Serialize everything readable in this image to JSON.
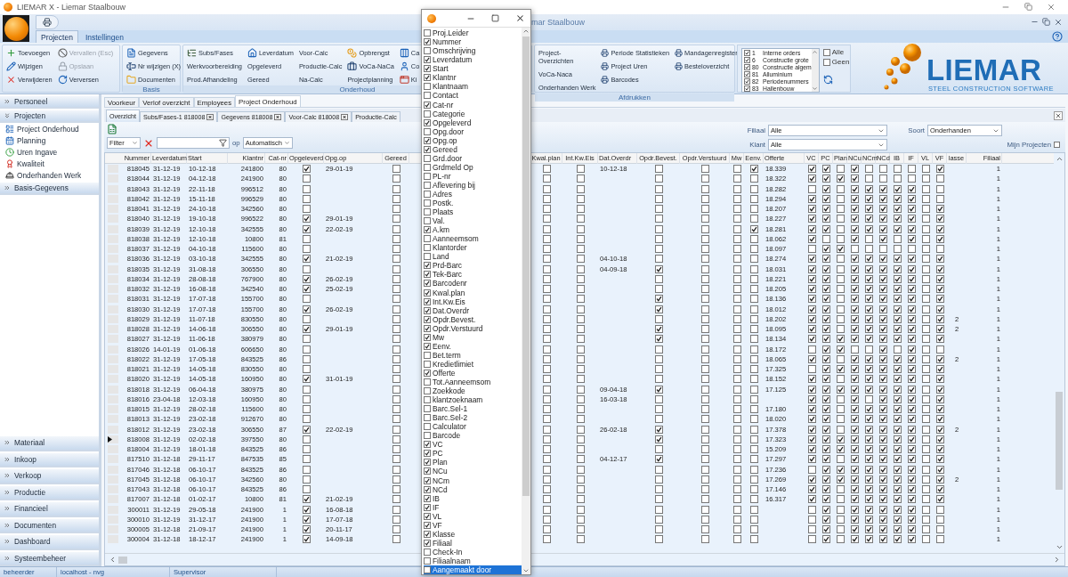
{
  "window": {
    "title": "LIEMAR X - Liemar Staalbouw"
  },
  "inner_window": {
    "title": "mar Staalbouw"
  },
  "ribbon_tabs": [
    {
      "label": "Projecten",
      "selected": true
    },
    {
      "label": "Instellingen",
      "selected": false
    }
  ],
  "ribbon_groups": [
    {
      "columns": [
        [
          {
            "label": "Toevoegen",
            "disabled": false
          },
          {
            "label": "Wijzigen",
            "disabled": false
          },
          {
            "label": "Verwijderen",
            "disabled": false
          }
        ],
        [
          {
            "label": "Vervallen (Esc)",
            "disabled": true
          },
          {
            "label": "Opslaan",
            "disabled": true
          },
          {
            "label": "Verversen",
            "disabled": false
          }
        ]
      ]
    },
    {
      "label": "Basis",
      "columns": [
        [
          {
            "label": "Gegevens",
            "disabled": false
          },
          {
            "label": "Nr wijzigen (X)",
            "disabled": false
          },
          {
            "label": "Documenten",
            "disabled": false
          }
        ]
      ]
    },
    {
      "label": "Onderhoud",
      "columns": [
        [
          {
            "label": "Subs/Fases",
            "disabled": false
          },
          {
            "label": "Werkvoorbereiding",
            "disabled": false
          },
          {
            "label": "Prod.Afhandeling",
            "disabled": false
          }
        ],
        [
          {
            "label": "Leverdatum",
            "disabled": false
          },
          {
            "label": "Opgeleverd",
            "disabled": false
          },
          {
            "label": "Gereed",
            "disabled": false
          }
        ],
        [
          {
            "label": "Voor-Calc",
            "disabled": false
          },
          {
            "label": "Productie-Calc",
            "disabled": false
          },
          {
            "label": "Na-Calc",
            "disabled": false
          }
        ],
        [
          {
            "label": "Opbrengst",
            "disabled": false
          },
          {
            "label": "VoCa-NaCa",
            "disabled": false
          },
          {
            "label": "Projectplanning",
            "disabled": false
          }
        ],
        [
          {
            "label": "Ca",
            "disabled": false
          },
          {
            "label": "Co",
            "disabled": false
          },
          {
            "label": "Ki",
            "disabled": false
          }
        ]
      ]
    },
    {
      "label": "Afdrukken",
      "columns": [
        [
          {
            "label": "Project-Overzichten",
            "disabled": false
          },
          {
            "label": "VoCa-Naca",
            "disabled": false
          },
          {
            "label": "Onderhanden Werk",
            "disabled": false
          }
        ],
        [
          {
            "label": "Periode Statistieken",
            "disabled": false
          },
          {
            "label": "Project Uren",
            "disabled": false
          },
          {
            "label": "Barcodes",
            "disabled": false
          }
        ],
        [
          {
            "label": "Mandagenregister",
            "disabled": false
          },
          {
            "label": "Besteloverzicht",
            "disabled": false
          }
        ]
      ]
    }
  ],
  "category_list": [
    {
      "code": "1",
      "label": "Interne orders",
      "checked": true
    },
    {
      "code": "6",
      "label": "Constructie grote",
      "checked": true
    },
    {
      "code": "80",
      "label": "Constructie algem",
      "checked": true
    },
    {
      "code": "81",
      "label": "Alluminium",
      "checked": true
    },
    {
      "code": "82",
      "label": "Periodenummers",
      "checked": true
    },
    {
      "code": "83",
      "label": "Hallenbouw",
      "checked": true
    }
  ],
  "category_options": [
    {
      "label": "Alle",
      "checked": false
    },
    {
      "label": "Geen",
      "checked": false
    }
  ],
  "logo": {
    "name": "LIEMAR",
    "tagline": "STEEL CONSTRUCTION SOFTWARE"
  },
  "sidebar": {
    "top": [
      {
        "label": "Personeel",
        "expanded": false
      },
      {
        "label": "Projecten",
        "expanded": true,
        "items": [
          {
            "label": "Project Onderhoud"
          },
          {
            "label": "Planning"
          },
          {
            "label": "Uren Ingave"
          },
          {
            "label": "Kwaliteit"
          },
          {
            "label": "Onderhanden Werk"
          }
        ]
      },
      {
        "label": "Basis-Gegevens",
        "expanded": false
      }
    ],
    "bottom": [
      {
        "label": "Materiaal",
        "expanded": false
      },
      {
        "label": "Inkoop",
        "expanded": false
      },
      {
        "label": "Verkoop",
        "expanded": false
      },
      {
        "label": "Productie",
        "expanded": false
      },
      {
        "label": "Financieel",
        "expanded": false
      },
      {
        "label": "Documenten",
        "expanded": false
      },
      {
        "label": "Dashboard",
        "expanded": false
      },
      {
        "label": "Systeembeheer",
        "expanded": false
      }
    ]
  },
  "main_tabs": [
    {
      "label": "Voorkeur",
      "selected": false
    },
    {
      "label": "Verlof overzicht",
      "selected": false
    },
    {
      "label": "Employees",
      "selected": false
    },
    {
      "label": "Project Onderhoud",
      "selected": true
    }
  ],
  "doc_tabs": [
    {
      "label": "Overzicht",
      "selected": true,
      "closable": false
    },
    {
      "label": "Subs/Fases-1 818008",
      "selected": false,
      "closable": true
    },
    {
      "label": "Gegevens 818008",
      "selected": false,
      "closable": true
    },
    {
      "label": "Voor-Calc 818008",
      "selected": false,
      "closable": true
    },
    {
      "label": "Productie-Calc",
      "selected": false,
      "closable": false
    }
  ],
  "filter": {
    "mode": "Filter",
    "op_label": "op",
    "match": "Automatisch"
  },
  "selectors": [
    {
      "label": "Filiaal",
      "value": "Alle"
    },
    {
      "label": "Klant",
      "value": "Alle"
    },
    {
      "label": "Soort",
      "value": "Onderhanden"
    }
  ],
  "mine": {
    "label": "Mijn Projecten",
    "checked": false
  },
  "table": {
    "left_columns": [
      {
        "label": "Nummer",
        "kind": "number"
      },
      {
        "label": "Leverdatum",
        "kind": "text"
      },
      {
        "label": "Start",
        "kind": "text"
      },
      {
        "label": "Klantnr",
        "kind": "number"
      },
      {
        "label": "Cat-nr",
        "kind": "number"
      },
      {
        "label": "Opgeleverd",
        "kind": "check"
      },
      {
        "label": "Opg.op",
        "kind": "text"
      },
      {
        "label": "Gereed",
        "kind": "check"
      }
    ],
    "right_columns": [
      {
        "label": "Kwal.plan",
        "kind": "check"
      },
      {
        "label": "Int.Kw.Eis",
        "kind": "check"
      },
      {
        "label": "Dat.Overdr",
        "kind": "text"
      },
      {
        "label": "Opdr.Bevest.",
        "kind": "check"
      },
      {
        "label": "Opdr.Verstuurd",
        "kind": "check"
      },
      {
        "label": "Mw",
        "kind": "check"
      },
      {
        "label": "Eenv.",
        "kind": "check"
      },
      {
        "label": "Offerte",
        "kind": "text"
      },
      {
        "label": "VC",
        "kind": "check"
      },
      {
        "label": "PC",
        "kind": "check"
      },
      {
        "label": "Plan",
        "kind": "check"
      },
      {
        "label": "NCu",
        "kind": "check"
      },
      {
        "label": "NCm",
        "kind": "check"
      },
      {
        "label": "NCd",
        "kind": "check"
      },
      {
        "label": "IB",
        "kind": "check"
      },
      {
        "label": "IF",
        "kind": "check"
      },
      {
        "label": "VL",
        "kind": "check"
      },
      {
        "label": "VF",
        "kind": "check"
      },
      {
        "label": "lasse",
        "kind": "center"
      },
      {
        "label": "Filiaal",
        "kind": "number"
      }
    ],
    "rows": [
      {
        "current": false,
        "nummer": "818045",
        "leverdatum": "31-12-19",
        "start": "10-12-18",
        "klantnr": "241800",
        "cat_nr": "80",
        "opg_op": "29-01-19",
        "dat_overdr": "10-12-18",
        "offerte": "18.339",
        "filiaal": "1",
        "checks": [
          true,
          false,
          false,
          false,
          false,
          false,
          false,
          true,
          true,
          true,
          false,
          true,
          false,
          false,
          false,
          false,
          false,
          true
        ]
      },
      {
        "current": false,
        "nummer": "818044",
        "leverdatum": "31-12-19",
        "start": "04-12-18",
        "klantnr": "241900",
        "cat_nr": "80",
        "offerte": "18.322",
        "filiaal": "1",
        "checks": [
          false,
          false,
          false,
          false,
          false,
          false,
          false,
          false,
          true,
          true,
          true,
          true,
          false,
          false,
          false,
          false,
          false,
          false
        ]
      },
      {
        "current": false,
        "nummer": "818043",
        "leverdatum": "31-12-19",
        "start": "22-11-18",
        "klantnr": "996512",
        "cat_nr": "80",
        "offerte": "18.282",
        "filiaal": "1",
        "checks": [
          false,
          false,
          false,
          false,
          false,
          false,
          false,
          false,
          false,
          true,
          false,
          true,
          true,
          true,
          true,
          true,
          false,
          false
        ]
      },
      {
        "current": false,
        "nummer": "818042",
        "leverdatum": "31-12-19",
        "start": "15-11-18",
        "klantnr": "996529",
        "cat_nr": "80",
        "offerte": "18.294",
        "filiaal": "1",
        "checks": [
          false,
          false,
          false,
          false,
          false,
          false,
          false,
          false,
          true,
          true,
          false,
          true,
          true,
          true,
          true,
          true,
          false,
          false
        ]
      },
      {
        "current": false,
        "nummer": "818041",
        "leverdatum": "31-12-19",
        "start": "24-10-18",
        "klantnr": "342560",
        "cat_nr": "80",
        "offerte": "18.207",
        "filiaal": "1",
        "checks": [
          false,
          false,
          false,
          false,
          false,
          false,
          false,
          false,
          true,
          true,
          false,
          true,
          true,
          true,
          true,
          true,
          false,
          true
        ]
      },
      {
        "current": false,
        "nummer": "818040",
        "leverdatum": "31-12-19",
        "start": "19-10-18",
        "klantnr": "996522",
        "cat_nr": "80",
        "opg_op": "29-01-19",
        "offerte": "18.227",
        "filiaal": "1",
        "checks": [
          true,
          false,
          false,
          false,
          false,
          false,
          false,
          false,
          true,
          true,
          false,
          true,
          true,
          true,
          true,
          true,
          false,
          true
        ]
      },
      {
        "current": false,
        "nummer": "818039",
        "leverdatum": "31-12-19",
        "start": "12-10-18",
        "klantnr": "342555",
        "cat_nr": "80",
        "opg_op": "22-02-19",
        "offerte": "18.281",
        "filiaal": "1",
        "checks": [
          true,
          false,
          false,
          false,
          false,
          false,
          false,
          true,
          true,
          true,
          false,
          true,
          true,
          true,
          true,
          true,
          false,
          true
        ]
      },
      {
        "current": false,
        "nummer": "818038",
        "leverdatum": "31-12-19",
        "start": "12-10-18",
        "klantnr": "10800",
        "cat_nr": "81",
        "offerte": "18.062",
        "filiaal": "1",
        "checks": [
          false,
          false,
          false,
          false,
          false,
          false,
          false,
          false,
          true,
          false,
          false,
          true,
          false,
          true,
          false,
          true,
          false,
          true
        ]
      },
      {
        "current": false,
        "nummer": "818037",
        "leverdatum": "31-12-19",
        "start": "04-10-18",
        "klantnr": "115600",
        "cat_nr": "80",
        "offerte": "18.097",
        "filiaal": "1",
        "checks": [
          false,
          false,
          false,
          false,
          false,
          false,
          false,
          false,
          false,
          true,
          true,
          false,
          false,
          false,
          false,
          false,
          false,
          false
        ]
      },
      {
        "current": false,
        "nummer": "818036",
        "leverdatum": "31-12-19",
        "start": "03-10-18",
        "klantnr": "342555",
        "cat_nr": "80",
        "opg_op": "21-02-19",
        "dat_overdr": "04-10-18",
        "offerte": "18.274",
        "filiaal": "1",
        "checks": [
          true,
          false,
          false,
          false,
          false,
          false,
          false,
          false,
          true,
          true,
          false,
          true,
          true,
          true,
          true,
          true,
          false,
          true
        ]
      },
      {
        "current": false,
        "nummer": "818035",
        "leverdatum": "31-12-19",
        "start": "31-08-18",
        "klantnr": "306550",
        "cat_nr": "80",
        "dat_overdr": "04-09-18",
        "offerte": "18.031",
        "filiaal": "1",
        "checks": [
          false,
          false,
          false,
          false,
          true,
          false,
          false,
          false,
          true,
          true,
          false,
          true,
          true,
          true,
          true,
          true,
          false,
          true
        ]
      },
      {
        "current": false,
        "nummer": "818034",
        "leverdatum": "31-12-19",
        "start": "28-08-18",
        "klantnr": "767900",
        "cat_nr": "80",
        "opg_op": "26-02-19",
        "offerte": "18.221",
        "filiaal": "1",
        "checks": [
          true,
          false,
          false,
          false,
          false,
          false,
          false,
          false,
          true,
          true,
          false,
          true,
          true,
          true,
          true,
          true,
          false,
          true
        ]
      },
      {
        "current": false,
        "nummer": "818032",
        "leverdatum": "31-12-19",
        "start": "16-08-18",
        "klantnr": "342540",
        "cat_nr": "80",
        "opg_op": "25-02-19",
        "offerte": "18.205",
        "filiaal": "1",
        "checks": [
          true,
          false,
          false,
          false,
          false,
          false,
          false,
          false,
          true,
          true,
          false,
          true,
          true,
          true,
          true,
          true,
          false,
          true
        ]
      },
      {
        "current": false,
        "nummer": "818031",
        "leverdatum": "31-12-19",
        "start": "17-07-18",
        "klantnr": "155700",
        "cat_nr": "80",
        "offerte": "18.136",
        "filiaal": "1",
        "checks": [
          false,
          false,
          false,
          false,
          true,
          false,
          false,
          false,
          true,
          true,
          false,
          true,
          true,
          true,
          true,
          true,
          false,
          true
        ]
      },
      {
        "current": false,
        "nummer": "818030",
        "leverdatum": "31-12-19",
        "start": "17-07-18",
        "klantnr": "155700",
        "cat_nr": "80",
        "opg_op": "26-02-19",
        "offerte": "18.012",
        "filiaal": "1",
        "checks": [
          true,
          false,
          false,
          false,
          true,
          false,
          false,
          false,
          true,
          true,
          false,
          true,
          true,
          true,
          true,
          true,
          false,
          true
        ]
      },
      {
        "current": false,
        "nummer": "818029",
        "leverdatum": "31-12-19",
        "start": "11-07-18",
        "klantnr": "830550",
        "cat_nr": "80",
        "offerte": "18.202",
        "klasse": "2",
        "filiaal": "1",
        "checks": [
          false,
          false,
          false,
          false,
          false,
          false,
          false,
          false,
          true,
          true,
          false,
          true,
          true,
          true,
          true,
          true,
          false,
          true
        ]
      },
      {
        "current": false,
        "nummer": "818028",
        "leverdatum": "31-12-19",
        "start": "14-06-18",
        "klantnr": "306550",
        "cat_nr": "80",
        "opg_op": "29-01-19",
        "offerte": "18.095",
        "klasse": "2",
        "filiaal": "1",
        "checks": [
          true,
          false,
          false,
          false,
          true,
          false,
          false,
          false,
          true,
          true,
          false,
          true,
          true,
          true,
          true,
          true,
          false,
          true
        ]
      },
      {
        "current": false,
        "nummer": "818027",
        "leverdatum": "31-12-19",
        "start": "11-06-18",
        "klantnr": "380979",
        "cat_nr": "80",
        "offerte": "18.134",
        "filiaal": "1",
        "checks": [
          false,
          false,
          false,
          false,
          true,
          false,
          false,
          false,
          true,
          true,
          true,
          true,
          true,
          true,
          true,
          true,
          false,
          true
        ]
      },
      {
        "current": false,
        "nummer": "818026",
        "leverdatum": "14-01-19",
        "start": "01-06-18",
        "klantnr": "606650",
        "cat_nr": "80",
        "offerte": "18.172",
        "filiaal": "1",
        "checks": [
          false,
          false,
          false,
          false,
          false,
          false,
          false,
          false,
          false,
          true,
          true,
          false,
          false,
          true,
          false,
          true,
          false,
          false
        ]
      },
      {
        "current": false,
        "nummer": "818022",
        "leverdatum": "31-12-19",
        "start": "17-05-18",
        "klantnr": "843525",
        "cat_nr": "86",
        "offerte": "18.065",
        "klasse": "2",
        "filiaal": "1",
        "checks": [
          false,
          false,
          false,
          false,
          false,
          false,
          false,
          false,
          true,
          true,
          false,
          true,
          true,
          true,
          true,
          true,
          false,
          true
        ]
      },
      {
        "current": false,
        "nummer": "818021",
        "leverdatum": "31-12-19",
        "start": "14-05-18",
        "klantnr": "830550",
        "cat_nr": "80",
        "offerte": "17.325",
        "filiaal": "1",
        "checks": [
          false,
          false,
          false,
          false,
          false,
          false,
          false,
          false,
          false,
          true,
          true,
          true,
          true,
          true,
          true,
          true,
          false,
          true
        ]
      },
      {
        "current": false,
        "nummer": "818020",
        "leverdatum": "31-12-19",
        "start": "14-05-18",
        "klantnr": "160950",
        "cat_nr": "80",
        "opg_op": "31-01-19",
        "offerte": "18.152",
        "filiaal": "1",
        "checks": [
          true,
          false,
          false,
          false,
          false,
          false,
          false,
          false,
          true,
          true,
          false,
          true,
          true,
          true,
          true,
          true,
          false,
          true
        ]
      },
      {
        "current": false,
        "nummer": "818018",
        "leverdatum": "31-12-19",
        "start": "06-04-18",
        "klantnr": "380975",
        "cat_nr": "80",
        "dat_overdr": "09-04-18",
        "offerte": "17.125",
        "filiaal": "1",
        "checks": [
          false,
          false,
          false,
          false,
          true,
          false,
          false,
          false,
          true,
          true,
          true,
          true,
          true,
          true,
          true,
          true,
          false,
          true
        ]
      },
      {
        "current": false,
        "nummer": "818016",
        "leverdatum": "23-04-18",
        "start": "12-03-18",
        "klantnr": "160950",
        "cat_nr": "80",
        "dat_overdr": "16-03-18",
        "filiaal": "1",
        "checks": [
          false,
          false,
          false,
          false,
          false,
          false,
          false,
          false,
          true,
          true,
          false,
          true,
          false,
          true,
          true,
          true,
          false,
          true
        ]
      },
      {
        "current": false,
        "nummer": "818015",
        "leverdatum": "31-12-19",
        "start": "28-02-18",
        "klantnr": "115600",
        "cat_nr": "80",
        "offerte": "17.180",
        "filiaal": "1",
        "checks": [
          false,
          false,
          false,
          false,
          false,
          false,
          false,
          false,
          true,
          true,
          false,
          true,
          true,
          true,
          true,
          true,
          false,
          true
        ]
      },
      {
        "current": false,
        "nummer": "818013",
        "leverdatum": "31-12-19",
        "start": "23-02-18",
        "klantnr": "912670",
        "cat_nr": "80",
        "offerte": "18.020",
        "filiaal": "1",
        "checks": [
          false,
          false,
          false,
          false,
          false,
          false,
          false,
          false,
          true,
          true,
          false,
          true,
          true,
          true,
          true,
          true,
          false,
          true
        ]
      },
      {
        "current": false,
        "nummer": "818012",
        "leverdatum": "31-12-19",
        "start": "23-02-18",
        "klantnr": "306550",
        "cat_nr": "87",
        "opg_op": "22-02-19",
        "dat_overdr": "26-02-18",
        "offerte": "17.378",
        "klasse": "2",
        "filiaal": "1",
        "checks": [
          true,
          false,
          false,
          false,
          true,
          false,
          false,
          false,
          true,
          true,
          false,
          true,
          true,
          true,
          true,
          true,
          false,
          true
        ]
      },
      {
        "current": true,
        "nummer": "818008",
        "leverdatum": "31-12-19",
        "start": "02-02-18",
        "klantnr": "397550",
        "cat_nr": "80",
        "offerte": "17.323",
        "filiaal": "1",
        "checks": [
          false,
          false,
          false,
          false,
          true,
          false,
          false,
          false,
          true,
          true,
          true,
          true,
          true,
          true,
          true,
          true,
          false,
          true
        ]
      },
      {
        "current": false,
        "nummer": "818004",
        "leverdatum": "31-12-19",
        "start": "18-01-18",
        "klantnr": "843525",
        "cat_nr": "86",
        "offerte": "15.209",
        "filiaal": "1",
        "checks": [
          false,
          false,
          false,
          false,
          false,
          false,
          false,
          false,
          true,
          true,
          true,
          true,
          true,
          true,
          true,
          true,
          false,
          true
        ]
      },
      {
        "current": false,
        "nummer": "817510",
        "leverdatum": "31-12-18",
        "start": "29-11-17",
        "klantnr": "847535",
        "cat_nr": "85",
        "dat_overdr": "04-12-17",
        "offerte": "17.297",
        "filiaal": "1",
        "checks": [
          false,
          false,
          false,
          false,
          true,
          false,
          false,
          false,
          true,
          true,
          false,
          true,
          true,
          true,
          true,
          true,
          false,
          true
        ]
      },
      {
        "current": false,
        "nummer": "817046",
        "leverdatum": "31-12-18",
        "start": "06-10-17",
        "klantnr": "843525",
        "cat_nr": "86",
        "offerte": "17.236",
        "filiaal": "1",
        "checks": [
          false,
          false,
          false,
          false,
          false,
          false,
          false,
          false,
          false,
          true,
          true,
          true,
          true,
          true,
          true,
          true,
          false,
          true
        ]
      },
      {
        "current": false,
        "nummer": "817045",
        "leverdatum": "31-12-18",
        "start": "06-10-17",
        "klantnr": "342560",
        "cat_nr": "80",
        "offerte": "17.269",
        "klasse": "2",
        "filiaal": "1",
        "checks": [
          false,
          false,
          false,
          false,
          false,
          false,
          false,
          false,
          true,
          true,
          true,
          true,
          true,
          true,
          true,
          true,
          false,
          true
        ]
      },
      {
        "current": false,
        "nummer": "817043",
        "leverdatum": "31-12-18",
        "start": "06-10-17",
        "klantnr": "843525",
        "cat_nr": "86",
        "offerte": "17.146",
        "filiaal": "1",
        "checks": [
          false,
          false,
          false,
          false,
          false,
          false,
          false,
          false,
          true,
          true,
          false,
          true,
          true,
          true,
          true,
          true,
          false,
          true
        ]
      },
      {
        "current": false,
        "nummer": "817007",
        "leverdatum": "31-12-18",
        "start": "01-02-17",
        "klantnr": "10800",
        "cat_nr": "81",
        "opg_op": "21-02-19",
        "offerte": "16.317",
        "filiaal": "1",
        "checks": [
          true,
          false,
          false,
          false,
          false,
          false,
          false,
          false,
          true,
          true,
          false,
          true,
          true,
          true,
          true,
          true,
          false,
          true
        ]
      },
      {
        "current": false,
        "nummer": "300011",
        "leverdatum": "31-12-19",
        "start": "29-05-18",
        "klantnr": "241900",
        "cat_nr": "1",
        "opg_op": "16-08-18",
        "filiaal": "1",
        "checks": [
          true,
          false,
          false,
          false,
          false,
          false,
          false,
          false,
          false,
          true,
          false,
          true,
          true,
          true,
          true,
          true,
          false,
          false
        ]
      },
      {
        "current": false,
        "nummer": "300010",
        "leverdatum": "31-12-19",
        "start": "31-12-17",
        "klantnr": "241900",
        "cat_nr": "1",
        "opg_op": "17-07-18",
        "filiaal": "1",
        "checks": [
          true,
          false,
          false,
          false,
          false,
          false,
          false,
          false,
          false,
          true,
          false,
          true,
          true,
          true,
          true,
          true,
          false,
          false
        ]
      },
      {
        "current": false,
        "nummer": "300005",
        "leverdatum": "31-12-18",
        "start": "21-09-17",
        "klantnr": "241900",
        "cat_nr": "1",
        "opg_op": "20-11-17",
        "filiaal": "1",
        "checks": [
          true,
          false,
          false,
          false,
          false,
          false,
          false,
          false,
          false,
          true,
          false,
          true,
          true,
          true,
          true,
          true,
          false,
          false
        ]
      },
      {
        "current": false,
        "nummer": "300004",
        "leverdatum": "31-12-18",
        "start": "18-12-17",
        "klantnr": "241900",
        "cat_nr": "1",
        "opg_op": "14-09-18",
        "filiaal": "1",
        "checks": [
          true,
          false,
          false,
          false,
          false,
          false,
          false,
          false,
          false,
          true,
          false,
          true,
          true,
          true,
          true,
          true,
          false,
          false
        ]
      }
    ]
  },
  "column_chooser": {
    "items": [
      {
        "label": "Proj.Leider",
        "checked": false,
        "selected": false
      },
      {
        "label": "Nummer",
        "checked": true,
        "selected": false
      },
      {
        "label": "Omschrijving",
        "checked": false,
        "selected": false
      },
      {
        "label": "Leverdatum",
        "checked": true,
        "selected": false
      },
      {
        "label": "Start",
        "checked": true,
        "selected": false
      },
      {
        "label": "Klantnr",
        "checked": true,
        "selected": false
      },
      {
        "label": "Klantnaam",
        "checked": false,
        "selected": false
      },
      {
        "label": "Contact",
        "checked": false,
        "selected": false
      },
      {
        "label": "Cat-nr",
        "checked": true,
        "selected": false
      },
      {
        "label": "Categorie",
        "checked": false,
        "selected": false
      },
      {
        "label": "Opgeleverd",
        "checked": true,
        "selected": false
      },
      {
        "label": "Opg.door",
        "checked": false,
        "selected": false
      },
      {
        "label": "Opg.op",
        "checked": true,
        "selected": false
      },
      {
        "label": "Gereed",
        "checked": true,
        "selected": false
      },
      {
        "label": "Grd.door",
        "checked": false,
        "selected": false
      },
      {
        "label": "Grdmeld Op",
        "checked": false,
        "selected": false
      },
      {
        "label": "PL-nr",
        "checked": false,
        "selected": false
      },
      {
        "label": "Aflevering bij",
        "checked": false,
        "selected": false
      },
      {
        "label": "Adres",
        "checked": false,
        "selected": false
      },
      {
        "label": "Postk.",
        "checked": false,
        "selected": false
      },
      {
        "label": "Plaats",
        "checked": false,
        "selected": false
      },
      {
        "label": "Val.",
        "checked": false,
        "selected": false
      },
      {
        "label": "A.km",
        "checked": true,
        "selected": false
      },
      {
        "label": "Aanneemsom",
        "checked": false,
        "selected": false
      },
      {
        "label": "Klantorder",
        "checked": false,
        "selected": false
      },
      {
        "label": "Land",
        "checked": false,
        "selected": false
      },
      {
        "label": "Prd-Barc",
        "checked": true,
        "selected": false
      },
      {
        "label": "Tek-Barc",
        "checked": true,
        "selected": false
      },
      {
        "label": "Barcodenr",
        "checked": true,
        "selected": false
      },
      {
        "label": "Kwal.plan",
        "checked": true,
        "selected": false
      },
      {
        "label": "Int.Kw.Eis",
        "checked": true,
        "selected": false
      },
      {
        "label": "Dat.Overdr",
        "checked": true,
        "selected": false
      },
      {
        "label": "Opdr.Bevest.",
        "checked": true,
        "selected": false
      },
      {
        "label": "Opdr.Verstuurd",
        "checked": true,
        "selected": false
      },
      {
        "label": "Mw",
        "checked": true,
        "selected": false
      },
      {
        "label": "Eenv.",
        "checked": true,
        "selected": false
      },
      {
        "label": "Bet.term",
        "checked": false,
        "selected": false
      },
      {
        "label": "Kredietlimiet",
        "checked": false,
        "selected": false
      },
      {
        "label": "Offerte",
        "checked": true,
        "selected": false
      },
      {
        "label": "Tot.Aanneemsom",
        "checked": false,
        "selected": false
      },
      {
        "label": "Zoekkode",
        "checked": false,
        "selected": false
      },
      {
        "label": "klantzoeknaam",
        "checked": false,
        "selected": false
      },
      {
        "label": "Barc.Sel-1",
        "checked": false,
        "selected": false
      },
      {
        "label": "Barc.Sel-2",
        "checked": false,
        "selected": false
      },
      {
        "label": "Calculator",
        "checked": false,
        "selected": false
      },
      {
        "label": "Barcode",
        "checked": false,
        "selected": false
      },
      {
        "label": "VC",
        "checked": true,
        "selected": false
      },
      {
        "label": "PC",
        "checked": true,
        "selected": false
      },
      {
        "label": "Plan",
        "checked": true,
        "selected": false
      },
      {
        "label": "NCu",
        "checked": true,
        "selected": false
      },
      {
        "label": "NCm",
        "checked": true,
        "selected": false
      },
      {
        "label": "NCd",
        "checked": true,
        "selected": false
      },
      {
        "label": "IB",
        "checked": true,
        "selected": false
      },
      {
        "label": "IF",
        "checked": true,
        "selected": false
      },
      {
        "label": "VL",
        "checked": true,
        "selected": false
      },
      {
        "label": "VF",
        "checked": true,
        "selected": false
      },
      {
        "label": "Klasse",
        "checked": true,
        "selected": false
      },
      {
        "label": "Filiaal",
        "checked": true,
        "selected": false
      },
      {
        "label": "Check-In",
        "checked": false,
        "selected": false
      },
      {
        "label": "Filiaalnaam",
        "checked": false,
        "selected": false
      },
      {
        "label": "Aangemaakt door",
        "checked": false,
        "selected": true
      }
    ]
  },
  "status_bar": [
    "beheerder",
    "localhost - nvg",
    "Supervisor"
  ]
}
